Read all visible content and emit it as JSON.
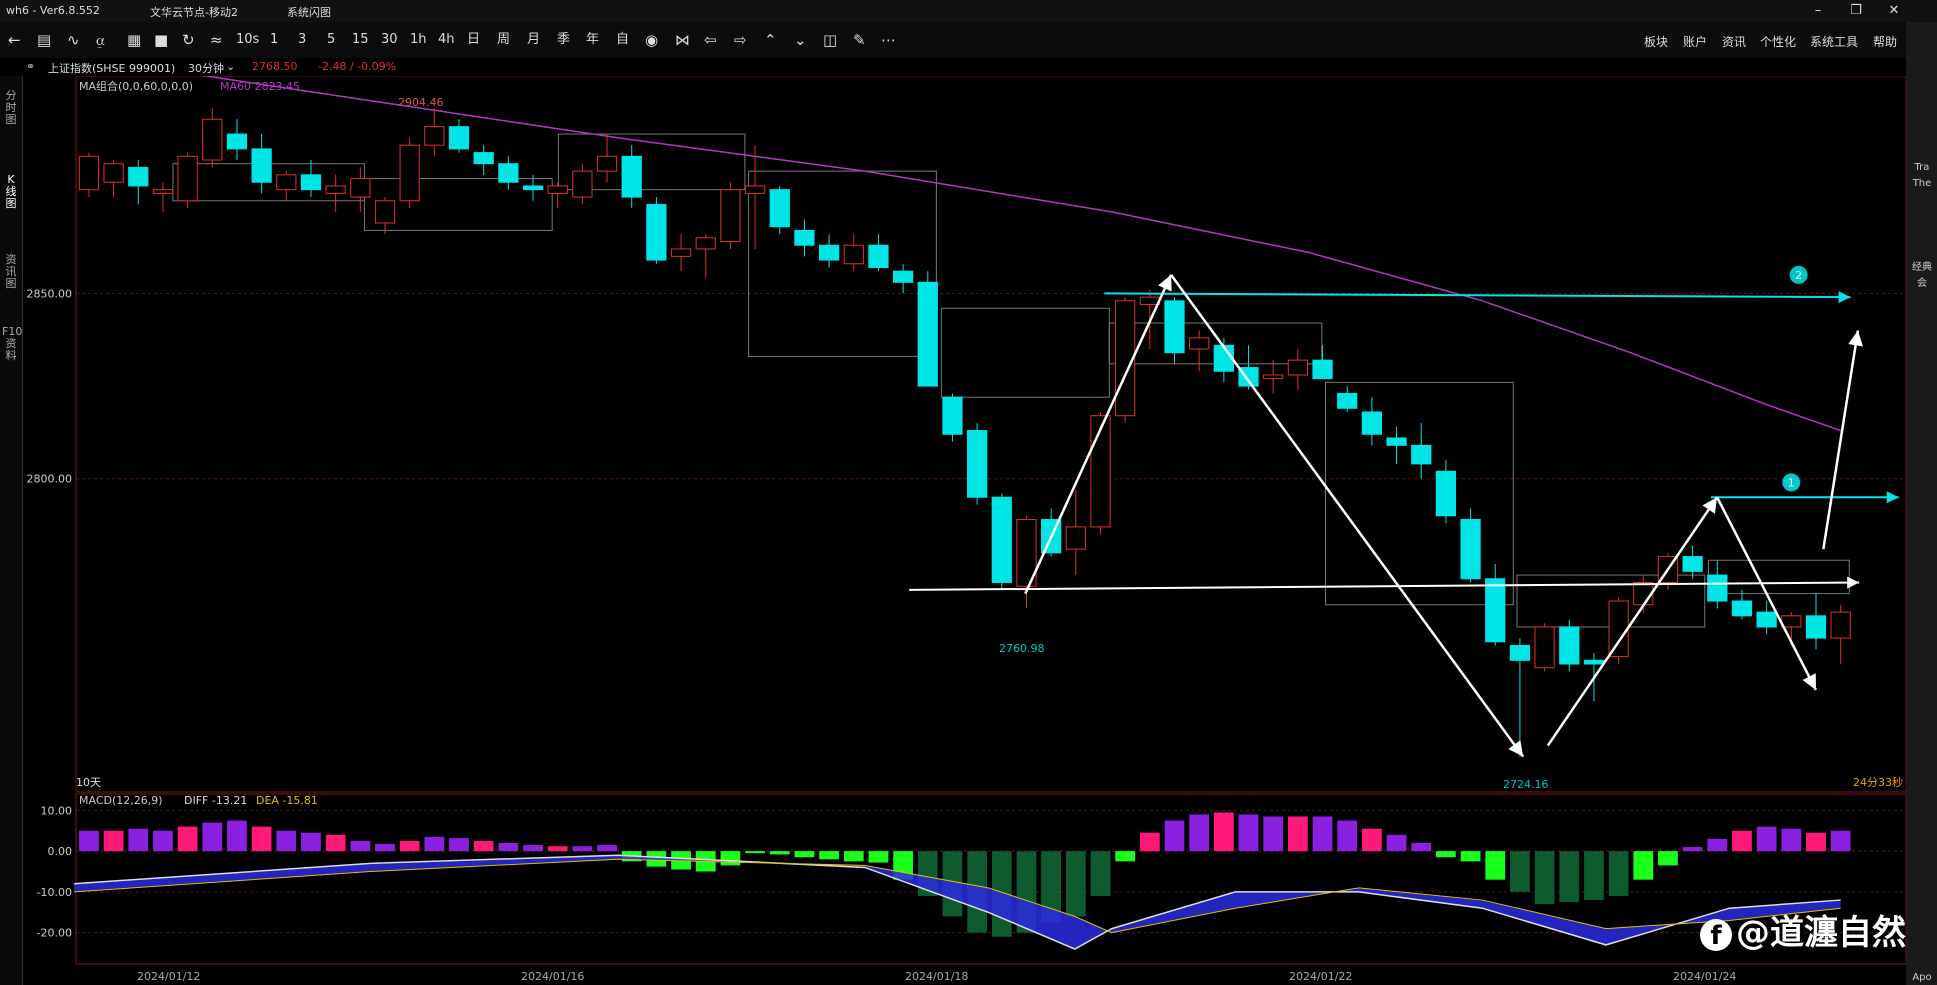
{
  "window": {
    "app_version": "wh6 - Ver6.8.552",
    "server": "文华云节点-移动2",
    "menu_label": "系统闪图"
  },
  "toolbar": {
    "icons": [
      "back",
      "list",
      "line",
      "yc",
      "bar",
      "save",
      "refresh",
      "tool"
    ],
    "periods": [
      "10s",
      "1",
      "3",
      "5",
      "15",
      "30",
      "1h",
      "4h",
      "日",
      "周",
      "月",
      "季",
      "年",
      "自"
    ],
    "nav_icons": [
      "eye",
      "bow",
      "left",
      "right",
      "up",
      "down",
      "layout",
      "pen",
      "more"
    ],
    "menus": [
      "板块",
      "账户",
      "资讯",
      "个性化",
      "系统工具",
      "帮助"
    ]
  },
  "info": {
    "instrument": "上证指数(SHSE 999001)",
    "period": "30分钟",
    "price": "2768.50",
    "change": "-2.48 / -0.09%"
  },
  "left_tabs": [
    "分时图",
    "K线图",
    "资讯图",
    "F10资料"
  ],
  "right_strip": {
    "items": [
      "Tra",
      "The",
      "经典",
      "会",
      "Apo"
    ]
  },
  "chart_data": {
    "type": "candlestick",
    "ma_label": "MA组合(0,0,60,0,0,0)",
    "ma60_label": "MA60 2823.45",
    "price_ticks": [
      {
        "label": "2850.00",
        "value": 2850
      },
      {
        "label": "2800.00",
        "value": 2800
      }
    ],
    "date_labels": [
      "2024/01/12",
      "2024/01/16",
      "2024/01/18",
      "2024/01/22",
      "2024/01/24"
    ],
    "annotations": {
      "high": "2904.46",
      "low1": "2760.98",
      "low2": "2724.16",
      "range": "10天",
      "timer": "24分33秒",
      "marker1": "1",
      "marker2": "2"
    },
    "colors": {
      "up": "#e03030",
      "down": "#00e5e5",
      "ma60": "#b03ac0",
      "grid": "#5a1a1a"
    },
    "candles": [
      [
        2878,
        2888,
        2876,
        2887
      ],
      [
        2880,
        2886,
        2876,
        2885
      ],
      [
        2884,
        2886,
        2874,
        2879
      ],
      [
        2877,
        2880,
        2872,
        2878
      ],
      [
        2875,
        2888,
        2873,
        2887
      ],
      [
        2886,
        2900,
        2884,
        2897
      ],
      [
        2893,
        2897,
        2886,
        2889
      ],
      [
        2889,
        2893,
        2877,
        2880
      ],
      [
        2878,
        2883,
        2875,
        2882
      ],
      [
        2882,
        2886,
        2876,
        2878
      ],
      [
        2877,
        2882,
        2872,
        2879
      ],
      [
        2876,
        2884,
        2872,
        2881
      ],
      [
        2869,
        2876,
        2866,
        2875
      ],
      [
        2875,
        2892,
        2873,
        2890
      ],
      [
        2890,
        2900,
        2887,
        2895
      ],
      [
        2895,
        2897,
        2888,
        2889
      ],
      [
        2888,
        2890,
        2882,
        2885
      ],
      [
        2885,
        2887,
        2878,
        2880
      ],
      [
        2879,
        2882,
        2875,
        2878
      ],
      [
        2877,
        2880,
        2873,
        2879
      ],
      [
        2876,
        2885,
        2874,
        2883
      ],
      [
        2883,
        2893,
        2880,
        2887
      ],
      [
        2887,
        2890,
        2873,
        2876
      ],
      [
        2874,
        2876,
        2858,
        2859
      ],
      [
        2860,
        2866,
        2856,
        2862
      ],
      [
        2862,
        2866,
        2854,
        2865
      ],
      [
        2864,
        2880,
        2862,
        2878
      ],
      [
        2877,
        2890,
        2862,
        2879
      ],
      [
        2878,
        2879,
        2866,
        2868
      ],
      [
        2867,
        2870,
        2860,
        2863
      ],
      [
        2863,
        2866,
        2857,
        2859
      ],
      [
        2858,
        2866,
        2856,
        2863
      ],
      [
        2863,
        2866,
        2856,
        2857
      ],
      [
        2856,
        2858,
        2850,
        2853
      ],
      [
        2853,
        2856,
        2825,
        2825
      ],
      [
        2822,
        2823,
        2810,
        2812
      ],
      [
        2813,
        2815,
        2793,
        2795
      ],
      [
        2795,
        2796,
        2770,
        2772
      ],
      [
        2771,
        2790,
        2765,
        2789
      ],
      [
        2789,
        2792,
        2779,
        2780
      ],
      [
        2781,
        2797,
        2774,
        2787
      ],
      [
        2787,
        2818,
        2785,
        2817
      ],
      [
        2817,
        2849,
        2815,
        2848
      ],
      [
        2847,
        2851,
        2835,
        2849
      ],
      [
        2848,
        2849,
        2831,
        2834
      ],
      [
        2835,
        2840,
        2829,
        2838
      ],
      [
        2836,
        2838,
        2826,
        2829
      ],
      [
        2830,
        2836,
        2824,
        2825
      ],
      [
        2827,
        2832,
        2823,
        2828
      ],
      [
        2828,
        2835,
        2824,
        2832
      ],
      [
        2832,
        2836,
        2827,
        2827
      ],
      [
        2823,
        2825,
        2818,
        2819
      ],
      [
        2818,
        2822,
        2809,
        2812
      ],
      [
        2811,
        2814,
        2804,
        2809
      ],
      [
        2809,
        2815,
        2800,
        2804
      ],
      [
        2802,
        2805,
        2788,
        2790
      ],
      [
        2789,
        2792,
        2772,
        2773
      ],
      [
        2773,
        2777,
        2755,
        2756
      ],
      [
        2755,
        2757,
        2725,
        2751
      ],
      [
        2749,
        2761,
        2748,
        2760
      ],
      [
        2760,
        2762,
        2748,
        2750
      ],
      [
        2751,
        2753,
        2740,
        2750
      ],
      [
        2752,
        2768,
        2750,
        2767
      ],
      [
        2766,
        2774,
        2764,
        2772
      ],
      [
        2772,
        2780,
        2770,
        2779
      ],
      [
        2779,
        2782,
        2773,
        2775
      ],
      [
        2774,
        2778,
        2765,
        2767
      ],
      [
        2767,
        2770,
        2762,
        2763
      ],
      [
        2764,
        2767,
        2758,
        2760
      ],
      [
        2760,
        2764,
        2755,
        2763
      ],
      [
        2763,
        2769,
        2754,
        2757
      ],
      [
        2757,
        2766,
        2750,
        2764
      ]
    ],
    "ma60": [
      [
        60,
        2914
      ],
      [
        300,
        2902
      ],
      [
        500,
        2892
      ],
      [
        700,
        2883
      ],
      [
        900,
        2872
      ],
      [
        1060,
        2861
      ],
      [
        1200,
        2848
      ],
      [
        1320,
        2834
      ],
      [
        1430,
        2820
      ],
      [
        1490,
        2813
      ]
    ],
    "boxes": [
      [
        140,
        2885,
        295,
        2875
      ],
      [
        295,
        2881,
        447,
        2867
      ],
      [
        452,
        2893,
        603,
        2878
      ],
      [
        606,
        2883,
        758,
        2833
      ],
      [
        762,
        2846,
        898,
        2822
      ],
      [
        898,
        2842,
        1070,
        2831
      ],
      [
        1073,
        2826,
        1225,
        2766
      ],
      [
        1228,
        2774,
        1380,
        2760
      ],
      [
        1383,
        2778,
        1497,
        2769
      ]
    ],
    "arrows": [
      [
        830,
        2769,
        948,
        2855
      ],
      [
        948,
        2855,
        1233,
        2725
      ],
      [
        1253,
        2728,
        1390,
        2795
      ],
      [
        1390,
        2795,
        1470,
        2743
      ],
      [
        1476,
        2781,
        1504,
        2840
      ]
    ],
    "hlines": [
      [
        736,
        2770,
        1505,
        2772,
        "#ffffff"
      ],
      [
        894,
        2850,
        1498,
        2849,
        "#00e5e5"
      ],
      [
        1385,
        2795,
        1537,
        2795,
        "#00e5e5"
      ]
    ],
    "macd": {
      "label": "MACD(12,26,9)",
      "diff": "DIFF -13.21",
      "dea": "DEA -15.81",
      "ticks": [
        {
          "label": "10.00",
          "value": 10
        },
        {
          "label": "0.00",
          "value": 0
        },
        {
          "label": "-10.00",
          "value": -10
        },
        {
          "label": "-20.00",
          "value": -20
        }
      ],
      "hist": [
        5,
        5,
        5.5,
        5,
        6,
        7,
        7.5,
        6,
        5,
        4.5,
        4,
        2.5,
        1.8,
        2.5,
        3.5,
        3.2,
        2.5,
        2,
        1.5,
        1.2,
        1.2,
        1.5,
        -2.5,
        -3.8,
        -4.5,
        -5,
        -3.5,
        -0.5,
        -0.8,
        -1.5,
        -2,
        -2.5,
        -2.8,
        -7,
        -11,
        -16,
        -20,
        -21,
        -20,
        -17.5,
        -16,
        -11,
        -2.5,
        4.5,
        7.5,
        9,
        9.5,
        9,
        8.5,
        8.5,
        8.5,
        7.5,
        5.5,
        4,
        2,
        -1.5,
        -2.5,
        -7,
        -10,
        -13,
        -12.5,
        -12,
        -11,
        -7,
        -3.5,
        1,
        3,
        5,
        6,
        5.5,
        4.5,
        5
      ],
      "diff_line": [
        [
          60,
          -8
        ],
        [
          300,
          -3
        ],
        [
          500,
          -1
        ],
        [
          700,
          -4
        ],
        [
          800,
          -15
        ],
        [
          870,
          -24
        ],
        [
          900,
          -19
        ],
        [
          1000,
          -10
        ],
        [
          1100,
          -10
        ],
        [
          1200,
          -14
        ],
        [
          1300,
          -23
        ],
        [
          1400,
          -14
        ],
        [
          1490,
          -12
        ]
      ],
      "dea_line": [
        [
          60,
          -10
        ],
        [
          300,
          -5
        ],
        [
          500,
          -2
        ],
        [
          700,
          -3.5
        ],
        [
          800,
          -9
        ],
        [
          870,
          -16
        ],
        [
          900,
          -20
        ],
        [
          1000,
          -14
        ],
        [
          1100,
          -9
        ],
        [
          1200,
          -12
        ],
        [
          1300,
          -19
        ],
        [
          1400,
          -17
        ],
        [
          1490,
          -14
        ]
      ]
    }
  }
}
